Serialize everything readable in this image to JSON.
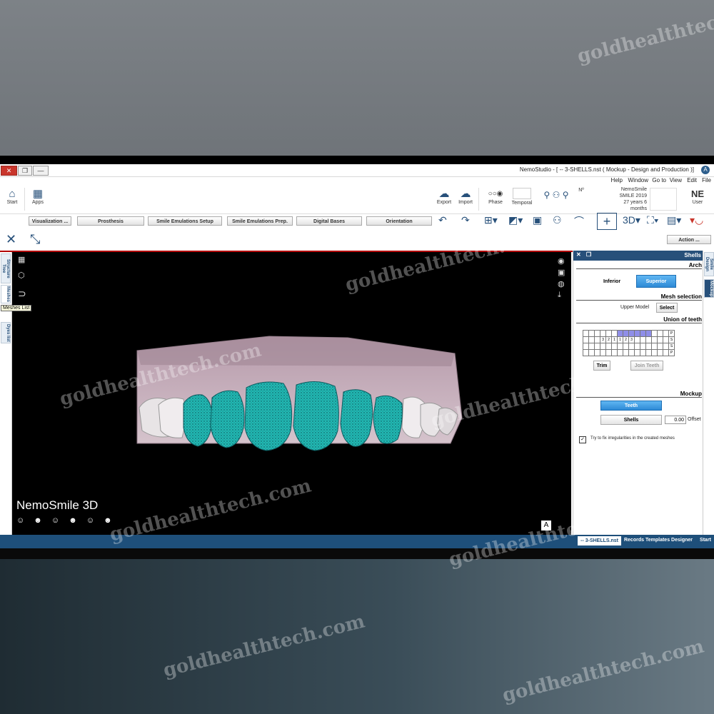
{
  "window": {
    "title": "NemoStudio - [ -- 3-SHELLS.nst ( Mockup - Design and Production )]",
    "close_glyph": "✕",
    "max_glyph": "❐",
    "min_glyph": "—"
  },
  "menu": [
    "File",
    "Edit",
    "View",
    "Go to",
    "Window",
    "Help"
  ],
  "patient": {
    "initials": "NE",
    "initials_sub": "User",
    "name": "NemoSmile",
    "line2": "SMILE 2019",
    "age": "27 years 6 months",
    "number_label": "Nº"
  },
  "ribbon": {
    "temporal_label": "Temporal",
    "phase_label": "Phase",
    "import_label": "Import",
    "export_label": "Export",
    "apps_label": "Apps",
    "start_label": "Start"
  },
  "tabs": {
    "visualization": "Visualization ...",
    "prosthesis": "Prosthesis",
    "smile_emulations_setup": "Smile Emulations Setup",
    "smile_emulations_prep": "Smile Emulations Prep.",
    "digital_bases": "Digital Bases",
    "orientation": "Orientation",
    "action": "Action ..."
  },
  "left_tabs": {
    "structure_tree": "Structure Tree",
    "meshes": "Meshes",
    "dyes_list": "Dyes list",
    "meshes_tooltip": "Meshes List"
  },
  "viewport": {
    "brand": "NemoSmile 3D",
    "axis_label": "A",
    "faces": "☺ ☻ ☺ ☻ ☺ ☻"
  },
  "panel": {
    "header": "Shells",
    "side_tab_1": "Smile Design",
    "side_tab_2": "Mockup",
    "arch_title": "Arch",
    "superior": "Superior",
    "inferior": "Inferior",
    "mesh_selection_title": "Mesh selection",
    "select_button": "Select",
    "upper_model": "Upper Model",
    "union_title": "Union of teeth",
    "join_teeth": "Join Teeth",
    "trim": "Trim",
    "mockup_title": "Mockup",
    "teeth_button": "Teeth",
    "offset_label": "Offset",
    "offset_value": "0.00",
    "shells_button": "Shells",
    "fix_irregularities": "Try to fix irregularities in the created meshes",
    "grid_rows": [
      [
        "P",
        "",
        "",
        "",
        "",
        "",
        "",
        "",
        "",
        "",
        "",
        "",
        "",
        "",
        "",
        ""
      ],
      [
        "S",
        "",
        "",
        "",
        "",
        "",
        "",
        "3",
        "2",
        "1",
        "1",
        "2",
        "3",
        "",
        "",
        ""
      ],
      [
        "S",
        "",
        "",
        "",
        "",
        "",
        "",
        "",
        "",
        "",
        "",
        "",
        "",
        "",
        "",
        ""
      ],
      [
        "P",
        "",
        "",
        "",
        "",
        "",
        "",
        "",
        "",
        "",
        "",
        "",
        "",
        "",
        "",
        ""
      ]
    ]
  },
  "bottom_tabs": {
    "start": "Start",
    "templates": "Templates Designer",
    "records": "Records",
    "file": "-- 3-SHELLS.nst"
  },
  "watermark": "goldhealthtech.com",
  "colors": {
    "accent": "#27507a",
    "teeth": "#1fb3b0",
    "selection_blue": "#2e8ad6",
    "alert_red": "#b40000"
  }
}
